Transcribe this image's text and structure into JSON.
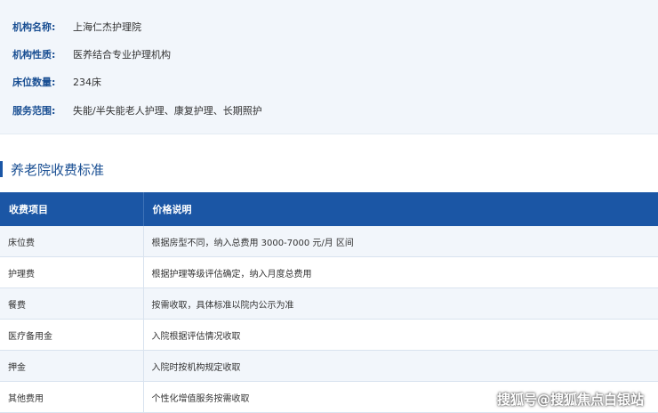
{
  "info": {
    "items": [
      {
        "label": "机构名称:",
        "value": "上海仁杰护理院"
      },
      {
        "label": "机构性质:",
        "value": "医养结合专业护理机构"
      },
      {
        "label": "床位数量:",
        "value": "234床"
      },
      {
        "label": "服务范围:",
        "value": "失能/半失能老人护理、康复护理、长期照护"
      }
    ]
  },
  "section": {
    "title": "养老院收费标准"
  },
  "table": {
    "headers": [
      "收费项目",
      "价格说明"
    ],
    "rows": [
      [
        "床位费",
        "根据房型不同，纳入总费用 3000-7000 元/月 区间"
      ],
      [
        "护理费",
        "根据护理等级评估确定，纳入月度总费用"
      ],
      [
        "餐费",
        "按需收取，具体标准以院内公示为准"
      ],
      [
        "医疗备用金",
        "入院根据评估情况收取"
      ],
      [
        "押金",
        "入院时按机构规定收取"
      ],
      [
        "其他费用",
        "个性化增值服务按需收取"
      ]
    ]
  },
  "watermark": "搜狐号@搜狐焦点白银站"
}
